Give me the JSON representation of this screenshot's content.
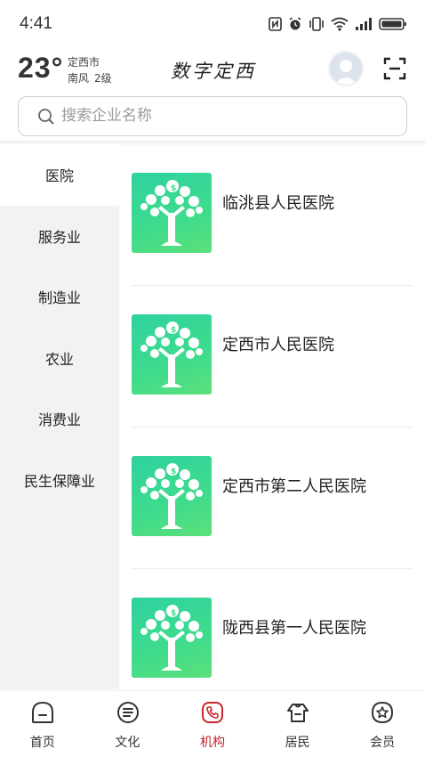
{
  "status_bar": {
    "time": "4:41",
    "icons": [
      "nfc-icon",
      "alarm-icon",
      "vibrate-icon",
      "wifi-icon",
      "signal-icon",
      "battery-icon"
    ]
  },
  "header": {
    "temperature": "23°",
    "city": "定西市",
    "wind_direction": "南风",
    "wind_level": "2级",
    "app_title": "数字定西",
    "avatar_icon": "user-avatar-icon",
    "scan_icon": "scan-icon"
  },
  "search": {
    "placeholder": "搜索企业名称",
    "value": ""
  },
  "sidebar": {
    "items": [
      {
        "label": "医院",
        "active": true
      },
      {
        "label": "服务业",
        "active": false
      },
      {
        "label": "制造业",
        "active": false
      },
      {
        "label": "农业",
        "active": false
      },
      {
        "label": "消费业",
        "active": false
      },
      {
        "label": "民生保障业",
        "active": false
      }
    ]
  },
  "organizations": [
    {
      "name": "临洮县人民医院",
      "thumb_icon": "money-tree-icon"
    },
    {
      "name": "定西市人民医院",
      "thumb_icon": "money-tree-icon"
    },
    {
      "name": "定西市第二人民医院",
      "thumb_icon": "money-tree-icon"
    },
    {
      "name": "陇西县第一人民医院",
      "thumb_icon": "money-tree-icon"
    }
  ],
  "bottom_nav": {
    "items": [
      {
        "label": "首页",
        "icon": "home-icon",
        "active": false
      },
      {
        "label": "文化",
        "icon": "document-icon",
        "active": false
      },
      {
        "label": "机构",
        "icon": "phone-icon",
        "active": true
      },
      {
        "label": "居民",
        "icon": "resident-icon",
        "active": false
      },
      {
        "label": "会员",
        "icon": "member-star-icon",
        "active": false
      }
    ]
  },
  "colors": {
    "accent": "#c8262c",
    "thumb_green": "#3fdc8c",
    "sidebar_bg": "#f2f2f2"
  }
}
